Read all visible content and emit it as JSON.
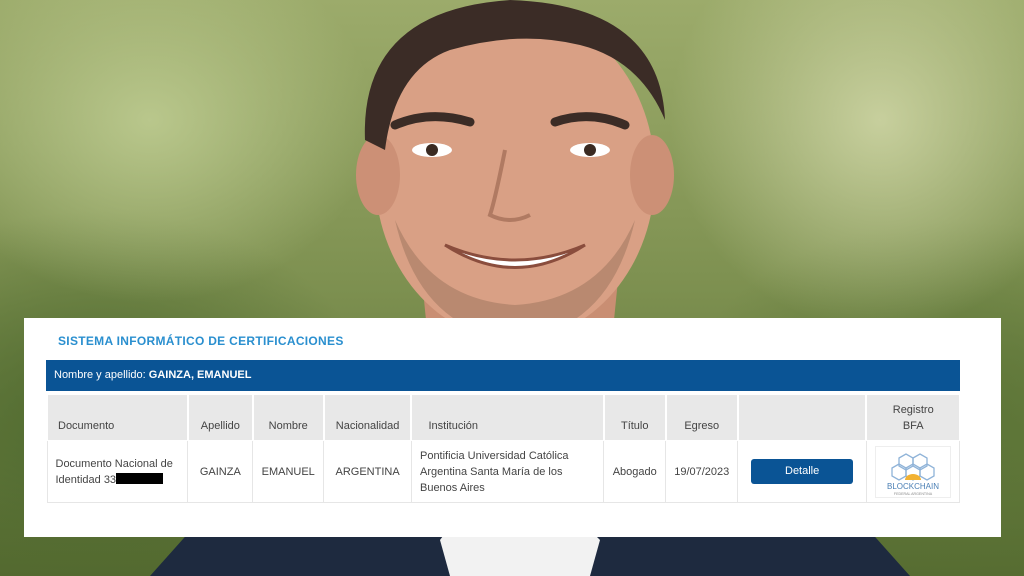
{
  "panel": {
    "title": "SISTEMA INFORMÁTICO DE CERTIFICACIONES",
    "name_label": "Nombre y apellido:",
    "name_value": "GAINZA, EMANUEL"
  },
  "table": {
    "headers": {
      "documento": "Documento",
      "apellido": "Apellido",
      "nombre": "Nombre",
      "nacionalidad": "Nacionalidad",
      "institucion": "Institución",
      "titulo": "Título",
      "egreso": "Egreso",
      "accion": "",
      "registro_line1": "Registro",
      "registro_line2": "BFA"
    },
    "row": {
      "documento_line1": "Documento Nacional de",
      "documento_line2": "Identidad 33",
      "apellido": "GAINZA",
      "nombre": "EMANUEL",
      "nacionalidad": "ARGENTINA",
      "institucion": "Pontificia Universidad Católica Argentina Santa María de los Buenos Aires",
      "titulo": "Abogado",
      "egreso": "19/07/2023",
      "detalle_label": "Detalle",
      "bfa_logo_text": "BLOCKCHAIN",
      "bfa_logo_subtext": "FEDERAL ARGENTINA"
    }
  },
  "colors": {
    "brand_blue": "#0a5495",
    "title_blue": "#2a8fcf"
  },
  "icons": {
    "bfa": "blockchain-federal-argentina-logo"
  }
}
